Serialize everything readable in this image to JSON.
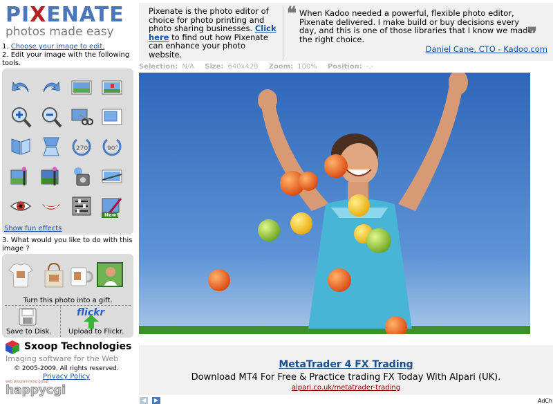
{
  "logo": {
    "word_start": "PI",
    "word_x": "X",
    "word_end": "ENATE",
    "tagline": "photos made easy"
  },
  "steps": {
    "step1_num": "1.",
    "step1_link": "Choose your image to edit.",
    "step2": "2. Edit your image with the following tools.",
    "fun_effects": "Show fun effects",
    "step3": "3. What would you like to do with this image ?"
  },
  "tools": [
    {
      "icon": "undo-icon"
    },
    {
      "icon": "redo-icon"
    },
    {
      "icon": "landscape-image-icon"
    },
    {
      "icon": "image-flag-icon"
    },
    {
      "icon": "zoom-in-icon"
    },
    {
      "icon": "zoom-out-icon"
    },
    {
      "icon": "crop-scissors-icon"
    },
    {
      "icon": "resize-image-icon"
    },
    {
      "icon": "flip-horizontal-icon"
    },
    {
      "icon": "flip-vertical-icon"
    },
    {
      "icon": "rotate-left-270-icon",
      "label": "270°"
    },
    {
      "icon": "rotate-right-90-icon",
      "label": "90°"
    },
    {
      "icon": "brightness-wand-icon"
    },
    {
      "icon": "contrast-wand-icon"
    },
    {
      "icon": "exposure-icon"
    },
    {
      "icon": "straighten-icon"
    },
    {
      "icon": "red-eye-icon"
    },
    {
      "icon": "teeth-whiten-icon"
    },
    {
      "icon": "adjust-sliders-icon"
    },
    {
      "icon": "draw-new-icon",
      "badge": "New!"
    }
  ],
  "gift": {
    "label": "Turn this photo into a gift."
  },
  "save": {
    "disk_label": "Save to Disk.",
    "flickr_label": "Upload to Flickr.",
    "flickr_logo": "flickr"
  },
  "company": {
    "name": "Sxoop Technologies",
    "tagline": "Imaging software for the Web",
    "copyright": "© 2005-2009. All rights reserved.",
    "privacy": "Privacy Policy",
    "badge_small": "web programming group",
    "badge_big": "happycgi"
  },
  "header": {
    "info_pre": "Pixenate is the photo editor of choice for photo printing and photo sharing businesses.",
    "info_link": "Click here",
    "info_post": " to find out how Pixenate can enhance your photo website.",
    "quote": "When Kadoo needed a powerful, flexible photo editor, Pixenate delivered. I make build or buy decisions every day, and this is one of those libraries that I know we made the right choice.",
    "cite": "Daniel Cane, CTO - Kadoo.com"
  },
  "status": {
    "selection_label": "Selection:",
    "selection": "N/A",
    "size_label": "Size:",
    "size": "640x428",
    "zoom_label": "Zoom:",
    "zoom": "100%",
    "position_label": "Position:",
    "position": "-,-"
  },
  "ad": {
    "title": "MetaTrader 4 FX Trading",
    "desc": "Download MT4 For Free & Practice trading FX Today With Alpari (UK).",
    "url": "alpari.co.uk/metatrader-trading",
    "adchoices": "AdCh"
  },
  "colors": {
    "accent": "#4b78b5",
    "link": "#1552a8",
    "panel": "#dcdcdc",
    "sky": "#3f78c6"
  }
}
